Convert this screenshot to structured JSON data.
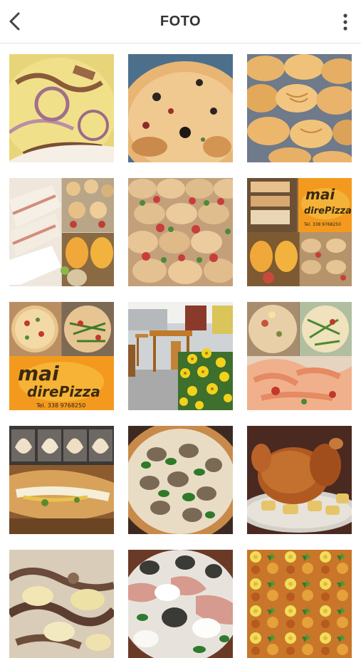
{
  "header": {
    "title": "FOTO",
    "back_icon": "chevron-left-icon",
    "menu_icon": "more-vertical-icon"
  },
  "colors": {
    "header_text": "#333333",
    "divider": "#e2e2e2",
    "logo_orange": "#f39a1e"
  },
  "gallery": {
    "photos": [
      {
        "subject": "pizza-onion"
      },
      {
        "subject": "focaccia-olives"
      },
      {
        "subject": "croissants"
      },
      {
        "subject": "sandwich-collage"
      },
      {
        "subject": "mini-sandwiches"
      },
      {
        "subject": "logo-collage"
      },
      {
        "subject": "pizza-logo-collage"
      },
      {
        "subject": "terrace-flowers"
      },
      {
        "subject": "pizza-salmon-collage"
      },
      {
        "subject": "calzone-collage"
      },
      {
        "subject": "eggplant-pizza"
      },
      {
        "subject": "roast-chicken"
      },
      {
        "subject": "pasta-bake"
      },
      {
        "subject": "prosciutto-pizza"
      },
      {
        "subject": "pattern-pastries"
      }
    ]
  },
  "logo": {
    "line1": "mai",
    "line2": "direPizza",
    "phone": "Tel. 338 9768250"
  }
}
